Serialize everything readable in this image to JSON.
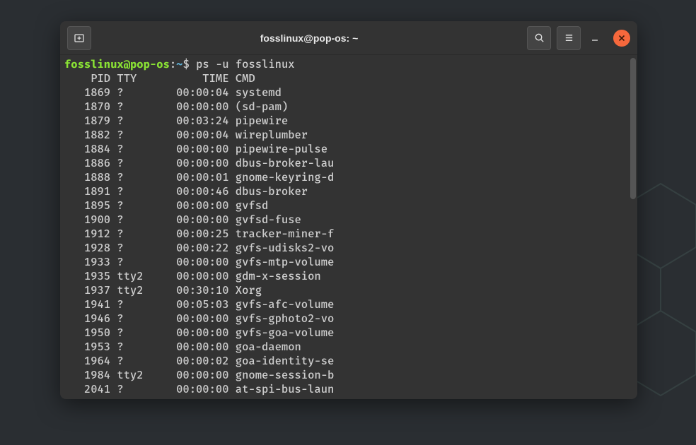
{
  "window": {
    "title": "fosslinux@pop-os: ~"
  },
  "prompt": {
    "user_host": "fosslinux@pop-os",
    "colon": ":",
    "path": "~",
    "symbol": "$",
    "command": "ps -u fosslinux"
  },
  "header": "    PID TTY          TIME CMD",
  "rows": [
    "   1869 ?        00:00:04 systemd",
    "   1870 ?        00:00:00 (sd-pam)",
    "   1879 ?        00:03:24 pipewire",
    "   1882 ?        00:00:04 wireplumber",
    "   1884 ?        00:00:00 pipewire-pulse",
    "   1886 ?        00:00:00 dbus-broker-lau",
    "   1888 ?        00:00:01 gnome-keyring-d",
    "   1891 ?        00:00:46 dbus-broker",
    "   1895 ?        00:00:00 gvfsd",
    "   1900 ?        00:00:00 gvfsd-fuse",
    "   1912 ?        00:00:25 tracker-miner-f",
    "   1928 ?        00:00:22 gvfs-udisks2-vo",
    "   1933 ?        00:00:00 gvfs-mtp-volume",
    "   1935 tty2     00:00:00 gdm-x-session",
    "   1937 tty2     00:30:10 Xorg",
    "   1941 ?        00:05:03 gvfs-afc-volume",
    "   1946 ?        00:00:00 gvfs-gphoto2-vo",
    "   1950 ?        00:00:00 gvfs-goa-volume",
    "   1953 ?        00:00:00 goa-daemon",
    "   1964 ?        00:00:02 goa-identity-se",
    "   1984 tty2     00:00:00 gnome-session-b",
    "   2041 ?        00:00:00 at-spi-bus-laun"
  ]
}
